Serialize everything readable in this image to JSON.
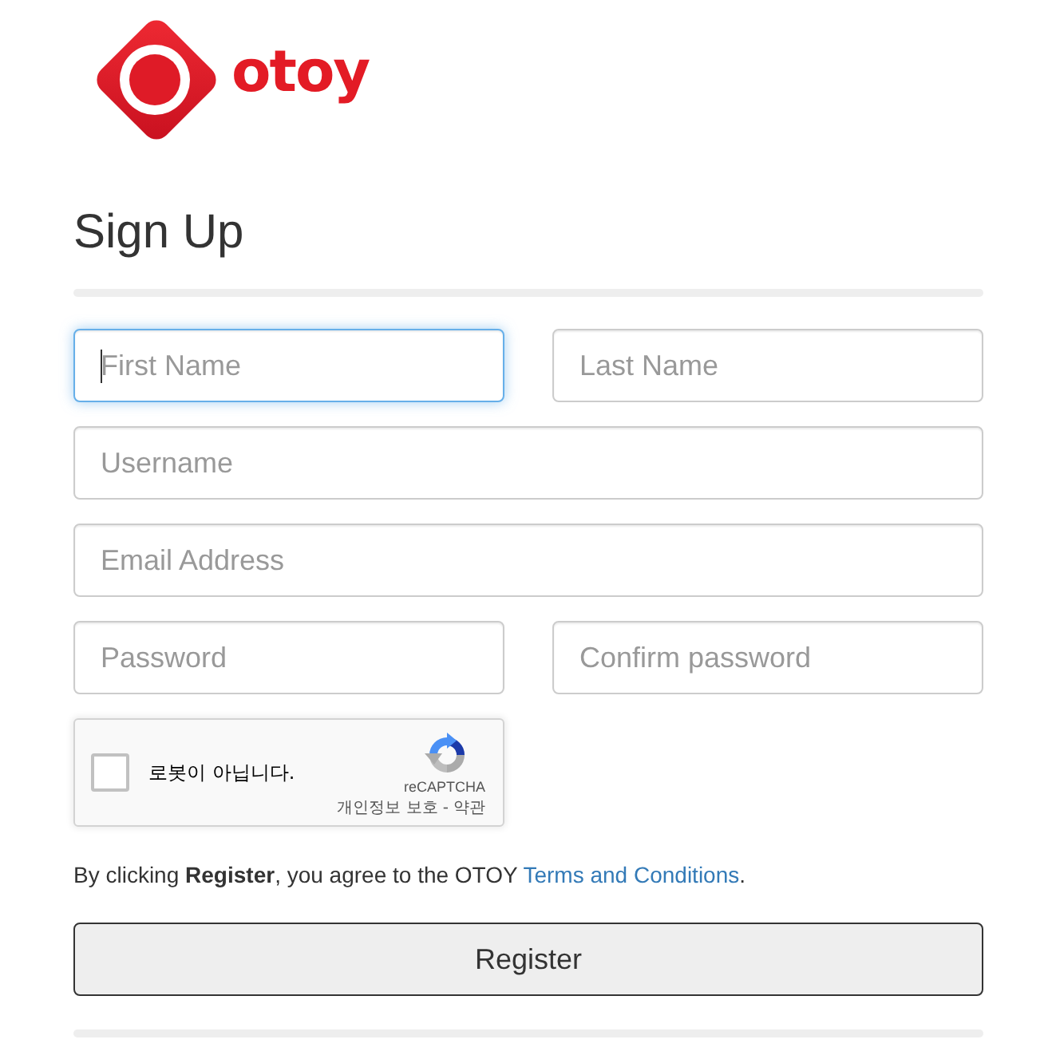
{
  "logo": {
    "wordmark": "otoy"
  },
  "heading": "Sign Up",
  "field_rows": [
    {
      "fields": [
        {
          "placeholder": "First Name",
          "focused": true
        },
        {
          "placeholder": "Last Name",
          "focused": false
        }
      ]
    },
    {
      "fields": [
        {
          "placeholder": "Username",
          "focused": false
        }
      ]
    },
    {
      "fields": [
        {
          "placeholder": "Email Address",
          "focused": false
        }
      ]
    },
    {
      "fields": [
        {
          "placeholder": "Password",
          "focused": false
        },
        {
          "placeholder": "Confirm password",
          "focused": false
        }
      ]
    }
  ],
  "captcha": {
    "checked": false,
    "label": "로봇이 아닙니다.",
    "brand": "reCAPTCHA",
    "privacy_link": "개인정보 보호",
    "separator": "-",
    "terms_link": "약관"
  },
  "agreement": {
    "text": "By clicking **Register**, you agree to the OTOY",
    "link": "Terms and Conditions",
    "end": "."
  },
  "button": {
    "label": "Register"
  }
}
